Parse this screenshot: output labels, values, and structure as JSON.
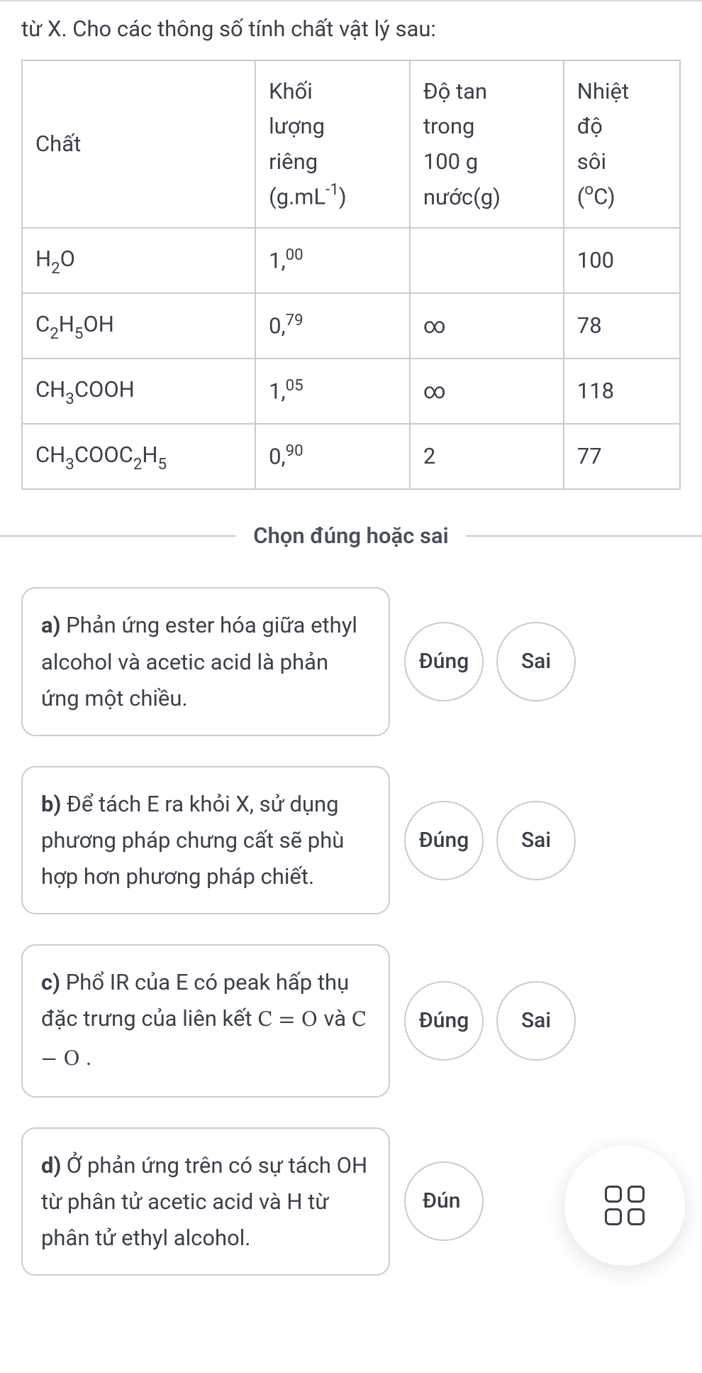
{
  "intro": "từ X. Cho các thông số tính chất vật lý sau:",
  "table": {
    "headers": {
      "c1": "Chất",
      "c2_line1": "Khối",
      "c2_line2": "lượng",
      "c2_line3": "riêng",
      "c2_line4_pre": "(g.mL",
      "c2_line4_sup": "-1",
      "c2_line4_post": ")",
      "c3_line1": "Độ tan",
      "c3_line2": "trong",
      "c3_line3": "100 g",
      "c3_line4": "nước(g)",
      "c4_line1": "Nhiệt",
      "c4_line2": "độ",
      "c4_line3": "sôi",
      "c4_line4_pre": "(",
      "c4_line4_sup": "o",
      "c4_line4_post": "C)"
    },
    "rows": [
      {
        "name_pre": "H",
        "name_sub1": "2",
        "name_mid": "O",
        "name_sub2": "",
        "name_post": "",
        "density_int": "1,",
        "density_sup": "00",
        "solubility": "",
        "bp": "100"
      },
      {
        "name_pre": "C",
        "name_sub1": "2",
        "name_mid": "H",
        "name_sub2": "5",
        "name_post": "OH",
        "density_int": "0,",
        "density_sup": "79",
        "solubility": "∞",
        "bp": "78"
      },
      {
        "name_pre": "CH",
        "name_sub1": "3",
        "name_mid": "COOH",
        "name_sub2": "",
        "name_post": "",
        "density_int": "1,",
        "density_sup": "05",
        "solubility": "∞",
        "bp": "118"
      },
      {
        "name_pre": "CH",
        "name_sub1": "3",
        "name_mid": "COOC",
        "name_sub2": "2",
        "name_post_pre": "H",
        "name_sub3": "5",
        "name_post": "",
        "density_int": "0,",
        "density_sup": "90",
        "solubility": "2",
        "bp": "77"
      }
    ]
  },
  "chart_data": {
    "type": "table",
    "title": "Thông số tính chất vật lý",
    "columns": [
      "Chất",
      "Khối lượng riêng (g.mL⁻¹)",
      "Độ tan trong 100 g nước (g)",
      "Nhiệt độ sôi (°C)"
    ],
    "rows": [
      [
        "H2O",
        1.0,
        null,
        100
      ],
      [
        "C2H5OH",
        0.79,
        "∞",
        78
      ],
      [
        "CH3COOH",
        1.05,
        "∞",
        118
      ],
      [
        "CH3COOC2H5",
        0.9,
        2,
        77
      ]
    ]
  },
  "divider": "Chọn đúng hoặc sai",
  "buttons": {
    "true": "Đúng",
    "false": "Sai",
    "true_partial": "Đún"
  },
  "questions": {
    "a": {
      "label": "a)",
      "text": " Phản ứng ester hóa giữa ethyl alcohol và acetic acid là phản ứng một chiều."
    },
    "b": {
      "label": "b)",
      "text": " Để tách E ra khỏi X, sử dụng phương pháp chưng cất sẽ phù hợp hơn phương pháp chiết."
    },
    "c": {
      "label": "c)",
      "text_pre": " Phổ IR của E có peak hấp thụ đặc trưng của liên kết ",
      "math1": "C = O",
      "mid": " và ",
      "math2": "C − O",
      "post": " ."
    },
    "d": {
      "label": "d)",
      "text": " Ở phản ứng trên có sự tách OH từ phân tử acetic acid và H từ phân tử ethyl alcohol."
    }
  }
}
